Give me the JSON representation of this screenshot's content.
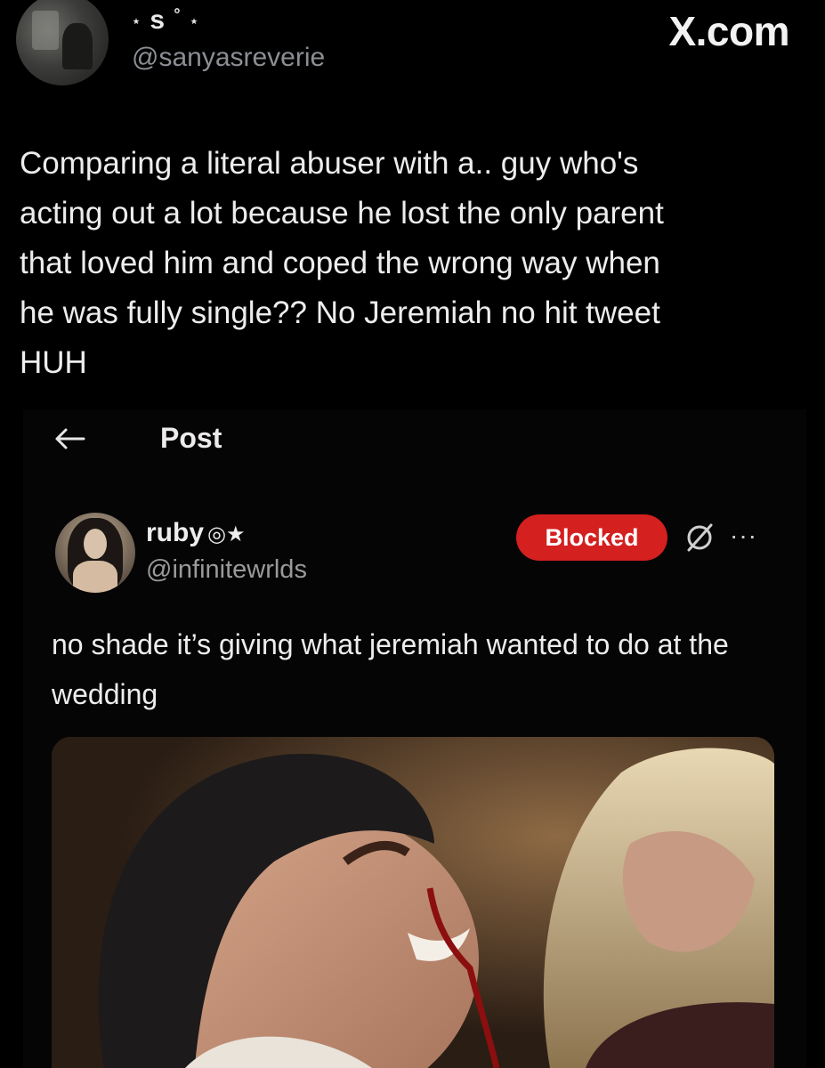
{
  "outer_tweet": {
    "display_name_letter": "s",
    "display_name_star": "⋆",
    "display_name_degree": "°",
    "handle": "@sanyasreverie",
    "brand": "X.com",
    "text": "Comparing a literal abuser with a.. guy who's\nacting out a lot because he lost the only parent\nthat loved him and coped the wrong way when\nhe was fully single?? No Jeremiah no hit tweet\nHUH"
  },
  "embedded_post": {
    "header_title": "Post",
    "author": {
      "name": "ruby",
      "name_icons": "◎★",
      "handle": "@infinitewrlds"
    },
    "blocked_label": "Blocked",
    "more_label": "···",
    "text": "no shade it’s giving what jeremiah wanted to do at the wedding"
  },
  "icons": {
    "back": "back-arrow-icon",
    "mute": "mute-icon",
    "more": "more-icon"
  },
  "colors": {
    "background": "#000000",
    "blocked_button": "#d4201f",
    "secondary_text": "#8b8f94",
    "primary_text": "#e7e9ea"
  }
}
